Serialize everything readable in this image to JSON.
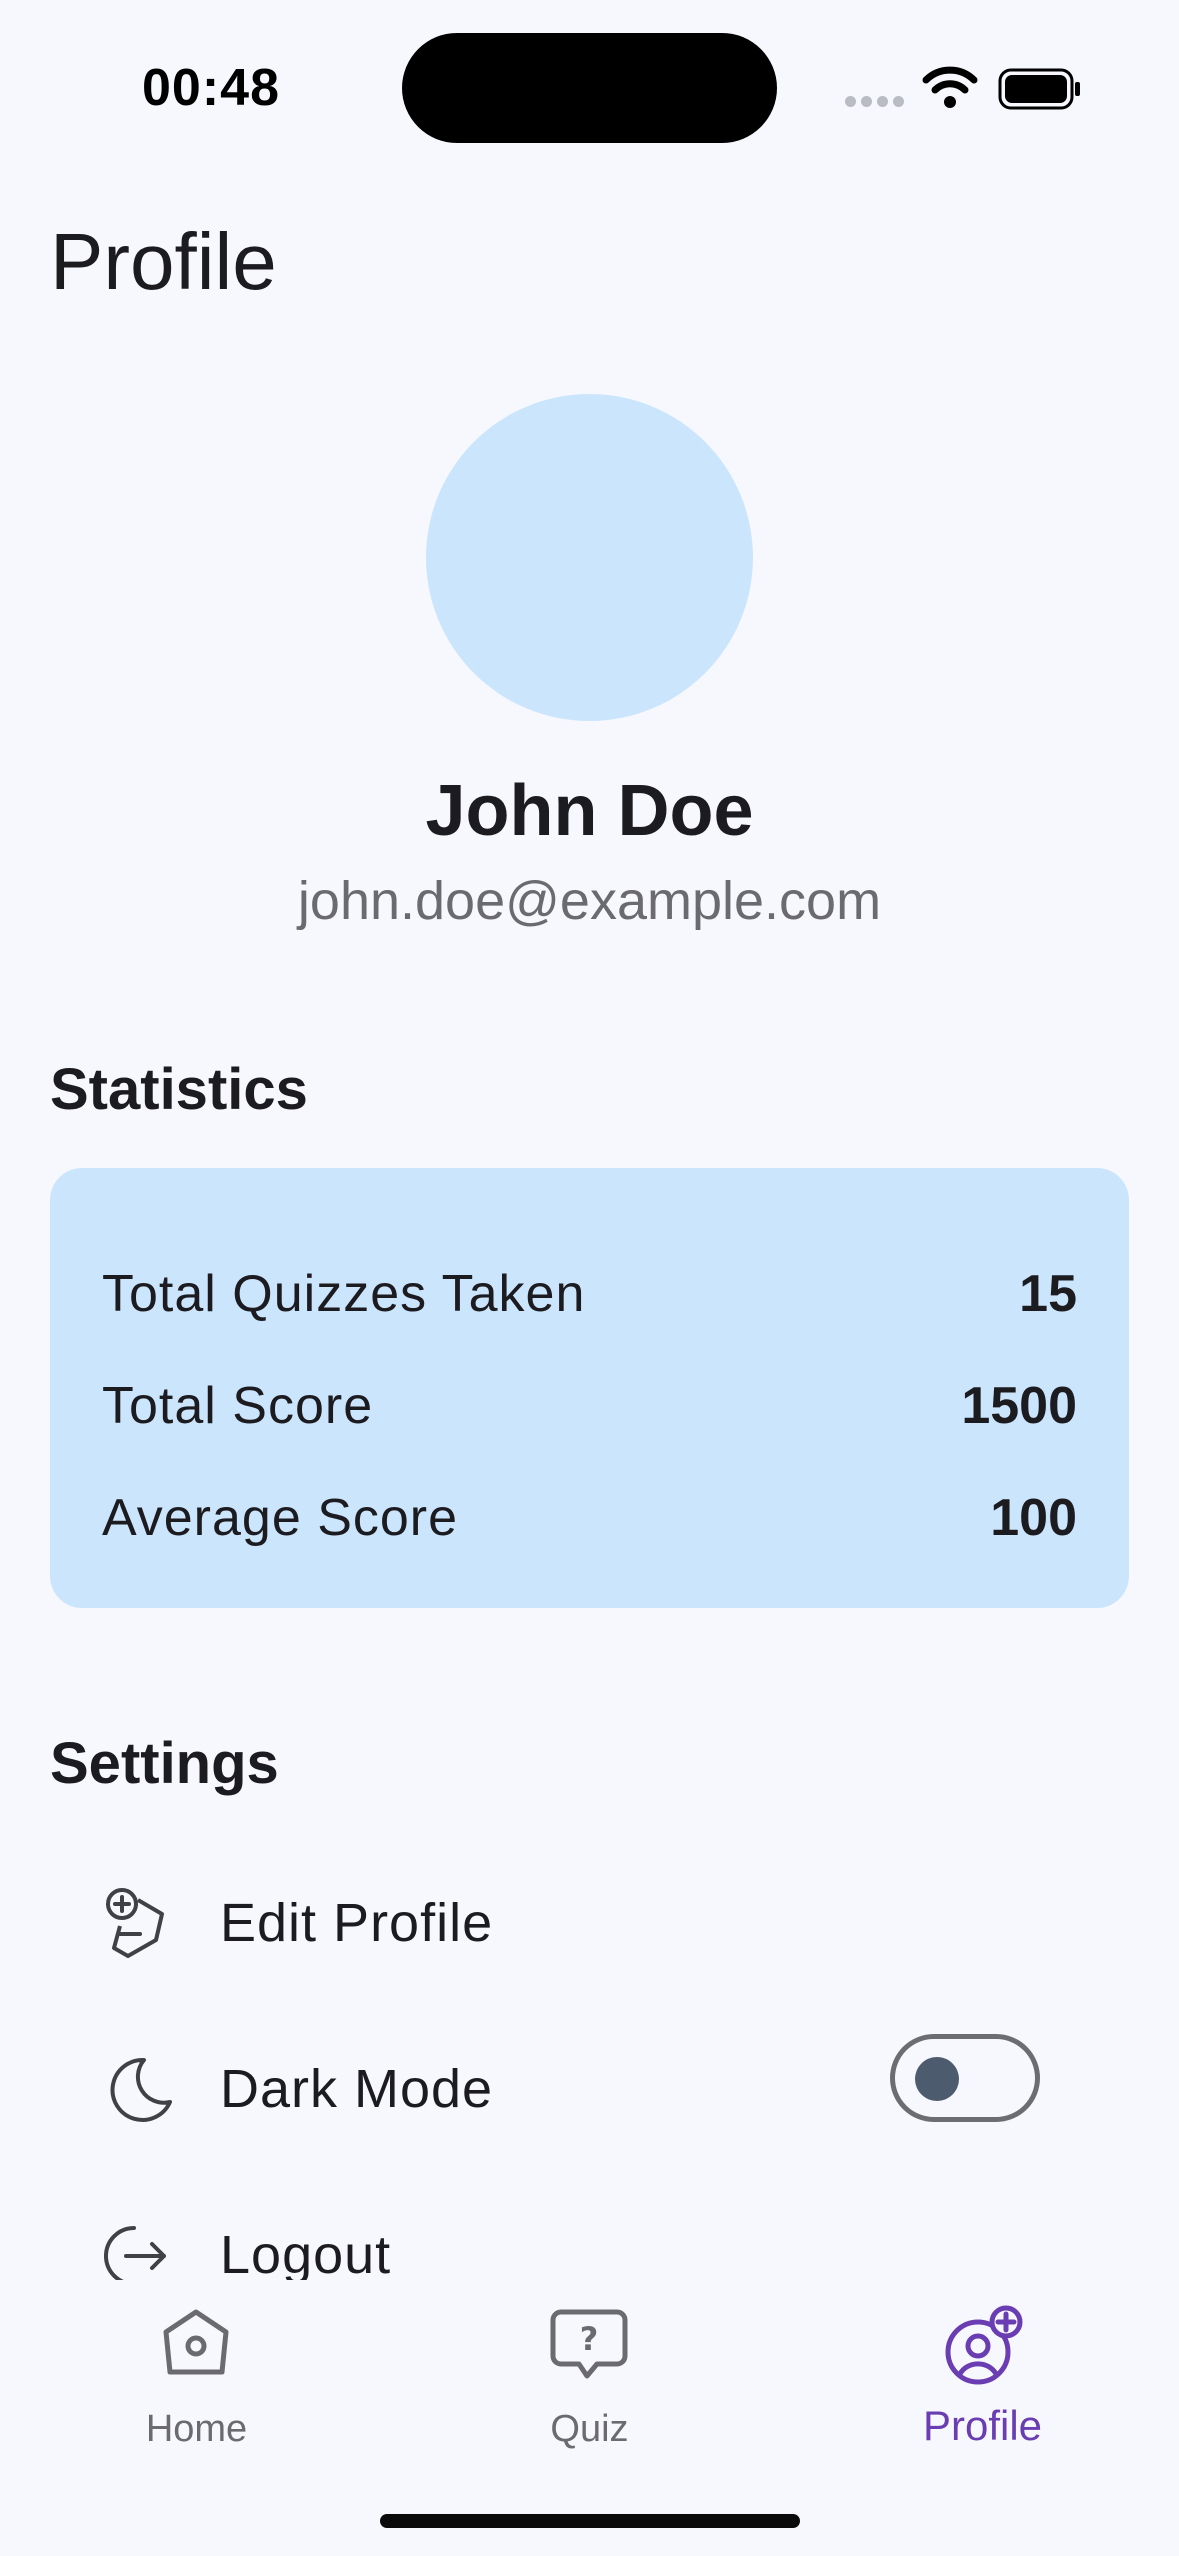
{
  "status_bar": {
    "time": "00:48"
  },
  "page": {
    "title": "Profile"
  },
  "user": {
    "name": "John Doe",
    "email": "john.doe@example.com"
  },
  "statistics": {
    "title": "Statistics",
    "rows": [
      {
        "label": "Total Quizzes Taken",
        "value": "15"
      },
      {
        "label": "Total Score",
        "value": "1500"
      },
      {
        "label": "Average Score",
        "value": "100"
      }
    ]
  },
  "settings": {
    "title": "Settings",
    "items": [
      {
        "label": "Edit Profile",
        "icon": "edit-profile-icon"
      },
      {
        "label": "Dark Mode",
        "icon": "moon-icon",
        "toggle_on": false
      },
      {
        "label": "Logout",
        "icon": "logout-icon"
      }
    ]
  },
  "nav": {
    "items": [
      {
        "label": "Home",
        "icon": "home-icon",
        "active": false
      },
      {
        "label": "Quiz",
        "icon": "quiz-icon",
        "active": false
      },
      {
        "label": "Profile",
        "icon": "profile-icon",
        "active": true
      }
    ]
  },
  "colors": {
    "background": "#f7f8fd",
    "card": "#cbe5fd",
    "accent": "#6a3db2",
    "text": "#1c1b20",
    "muted": "#6b6a70"
  }
}
